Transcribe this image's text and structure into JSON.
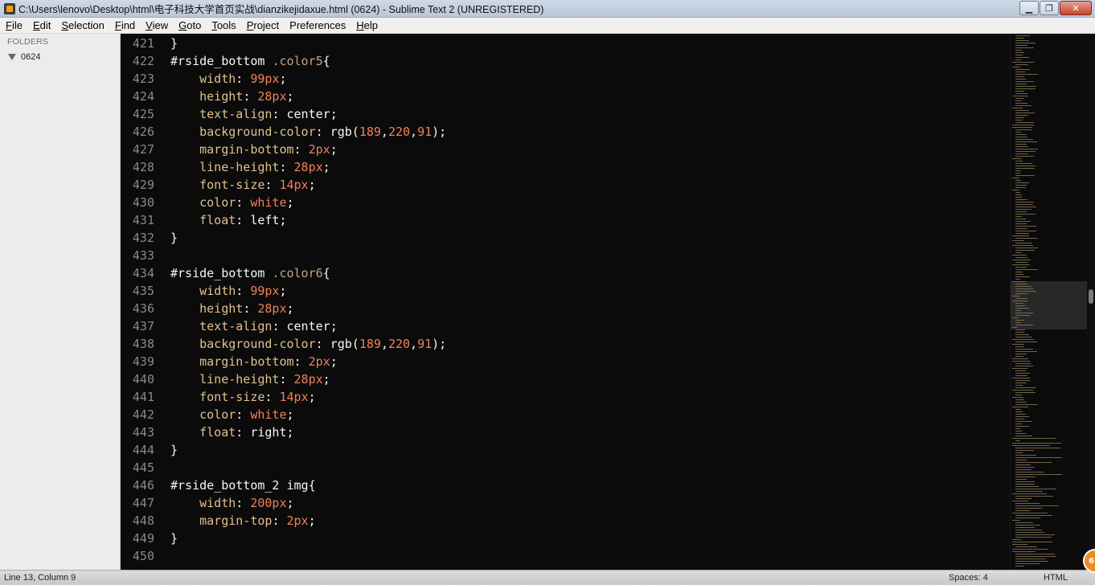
{
  "window": {
    "title": "C:\\Users\\lenovo\\Desktop\\html\\电子科技大学首页实战\\dianzikejidaxue.html (0624) - Sublime Text 2 (UNREGISTERED)",
    "minimize_glyph": "▁",
    "restore_glyph": "❐",
    "close_glyph": "✕"
  },
  "menu": [
    {
      "label": "File",
      "u": "F",
      "rest": "ile"
    },
    {
      "label": "Edit",
      "u": "E",
      "rest": "dit"
    },
    {
      "label": "Selection",
      "u": "S",
      "rest": "election"
    },
    {
      "label": "Find",
      "u": "F",
      "rest": "ind"
    },
    {
      "label": "View",
      "u": "V",
      "rest": "iew"
    },
    {
      "label": "Goto",
      "u": "G",
      "rest": "oto"
    },
    {
      "label": "Tools",
      "u": "T",
      "rest": "ools"
    },
    {
      "label": "Project",
      "u": "P",
      "rest": "roject"
    },
    {
      "label": "Preferences",
      "u": "",
      "rest": "Preferences"
    },
    {
      "label": "Help",
      "u": "H",
      "rest": "elp"
    }
  ],
  "sidebar": {
    "header": "FOLDERS",
    "folder": "0624"
  },
  "editor": {
    "lines": [
      {
        "n": "421",
        "tokens": [
          [
            "pun",
            "}"
          ]
        ]
      },
      {
        "n": "422",
        "tokens": [
          [
            "sel",
            "#rside_bottom "
          ],
          [
            "cls",
            ".color5"
          ],
          [
            "pun",
            "{"
          ]
        ]
      },
      {
        "n": "423",
        "tokens": [
          [
            "pun",
            "    "
          ],
          [
            "prop",
            "width"
          ],
          [
            "pun",
            ": "
          ],
          [
            "num",
            "99px"
          ],
          [
            "pun",
            ";"
          ]
        ]
      },
      {
        "n": "424",
        "tokens": [
          [
            "pun",
            "    "
          ],
          [
            "prop",
            "height"
          ],
          [
            "pun",
            ": "
          ],
          [
            "num",
            "28px"
          ],
          [
            "pun",
            ";"
          ]
        ]
      },
      {
        "n": "425",
        "tokens": [
          [
            "pun",
            "    "
          ],
          [
            "prop",
            "text-align"
          ],
          [
            "pun",
            ": "
          ],
          [
            "fn",
            "center"
          ],
          [
            "pun",
            ";"
          ]
        ]
      },
      {
        "n": "426",
        "tokens": [
          [
            "pun",
            "    "
          ],
          [
            "prop",
            "background-color"
          ],
          [
            "pun",
            ": "
          ],
          [
            "fn",
            "rgb("
          ],
          [
            "num",
            "189"
          ],
          [
            "pun",
            ","
          ],
          [
            "num",
            "220"
          ],
          [
            "pun",
            ","
          ],
          [
            "num",
            "91"
          ],
          [
            "pun",
            ");"
          ]
        ]
      },
      {
        "n": "427",
        "tokens": [
          [
            "pun",
            "    "
          ],
          [
            "prop",
            "margin-bottom"
          ],
          [
            "pun",
            ": "
          ],
          [
            "num",
            "2px"
          ],
          [
            "pun",
            ";"
          ]
        ]
      },
      {
        "n": "428",
        "tokens": [
          [
            "pun",
            "    "
          ],
          [
            "prop",
            "line-height"
          ],
          [
            "pun",
            ": "
          ],
          [
            "num",
            "28px"
          ],
          [
            "pun",
            ";"
          ]
        ]
      },
      {
        "n": "429",
        "tokens": [
          [
            "pun",
            "    "
          ],
          [
            "prop",
            "font-size"
          ],
          [
            "pun",
            ": "
          ],
          [
            "num",
            "14px"
          ],
          [
            "pun",
            ";"
          ]
        ]
      },
      {
        "n": "430",
        "tokens": [
          [
            "pun",
            "    "
          ],
          [
            "prop",
            "color"
          ],
          [
            "pun",
            ": "
          ],
          [
            "kw",
            "white"
          ],
          [
            "pun",
            ";"
          ]
        ]
      },
      {
        "n": "431",
        "tokens": [
          [
            "pun",
            "    "
          ],
          [
            "prop",
            "float"
          ],
          [
            "pun",
            ": "
          ],
          [
            "fn",
            "left"
          ],
          [
            "pun",
            ";"
          ]
        ]
      },
      {
        "n": "432",
        "tokens": [
          [
            "pun",
            "}"
          ]
        ]
      },
      {
        "n": "433",
        "tokens": []
      },
      {
        "n": "434",
        "tokens": [
          [
            "sel",
            "#rside_bottom "
          ],
          [
            "cls",
            ".color6"
          ],
          [
            "pun",
            "{"
          ]
        ]
      },
      {
        "n": "435",
        "tokens": [
          [
            "pun",
            "    "
          ],
          [
            "prop",
            "width"
          ],
          [
            "pun",
            ": "
          ],
          [
            "num",
            "99px"
          ],
          [
            "pun",
            ";"
          ]
        ]
      },
      {
        "n": "436",
        "tokens": [
          [
            "pun",
            "    "
          ],
          [
            "prop",
            "height"
          ],
          [
            "pun",
            ": "
          ],
          [
            "num",
            "28px"
          ],
          [
            "pun",
            ";"
          ]
        ]
      },
      {
        "n": "437",
        "tokens": [
          [
            "pun",
            "    "
          ],
          [
            "prop",
            "text-align"
          ],
          [
            "pun",
            ": "
          ],
          [
            "fn",
            "center"
          ],
          [
            "pun",
            ";"
          ]
        ]
      },
      {
        "n": "438",
        "tokens": [
          [
            "pun",
            "    "
          ],
          [
            "prop",
            "background-color"
          ],
          [
            "pun",
            ": "
          ],
          [
            "fn",
            "rgb("
          ],
          [
            "num",
            "189"
          ],
          [
            "pun",
            ","
          ],
          [
            "num",
            "220"
          ],
          [
            "pun",
            ","
          ],
          [
            "num",
            "91"
          ],
          [
            "pun",
            ");"
          ]
        ]
      },
      {
        "n": "439",
        "tokens": [
          [
            "pun",
            "    "
          ],
          [
            "prop",
            "margin-bottom"
          ],
          [
            "pun",
            ": "
          ],
          [
            "num",
            "2px"
          ],
          [
            "pun",
            ";"
          ]
        ]
      },
      {
        "n": "440",
        "tokens": [
          [
            "pun",
            "    "
          ],
          [
            "prop",
            "line-height"
          ],
          [
            "pun",
            ": "
          ],
          [
            "num",
            "28px"
          ],
          [
            "pun",
            ";"
          ]
        ]
      },
      {
        "n": "441",
        "tokens": [
          [
            "pun",
            "    "
          ],
          [
            "prop",
            "font-size"
          ],
          [
            "pun",
            ": "
          ],
          [
            "num",
            "14px"
          ],
          [
            "pun",
            ";"
          ]
        ]
      },
      {
        "n": "442",
        "tokens": [
          [
            "pun",
            "    "
          ],
          [
            "prop",
            "color"
          ],
          [
            "pun",
            ": "
          ],
          [
            "kw",
            "white"
          ],
          [
            "pun",
            ";"
          ]
        ]
      },
      {
        "n": "443",
        "tokens": [
          [
            "pun",
            "    "
          ],
          [
            "prop",
            "float"
          ],
          [
            "pun",
            ": "
          ],
          [
            "fn",
            "right"
          ],
          [
            "pun",
            ";"
          ]
        ]
      },
      {
        "n": "444",
        "tokens": [
          [
            "pun",
            "}"
          ]
        ]
      },
      {
        "n": "445",
        "tokens": []
      },
      {
        "n": "446",
        "tokens": [
          [
            "sel",
            "#rside_bottom_2 "
          ],
          [
            "fn",
            "img"
          ],
          [
            "pun",
            "{"
          ]
        ]
      },
      {
        "n": "447",
        "tokens": [
          [
            "pun",
            "    "
          ],
          [
            "prop",
            "width"
          ],
          [
            "pun",
            ": "
          ],
          [
            "num",
            "200px"
          ],
          [
            "pun",
            ";"
          ]
        ]
      },
      {
        "n": "448",
        "tokens": [
          [
            "pun",
            "    "
          ],
          [
            "prop",
            "margin-top"
          ],
          [
            "pun",
            ": "
          ],
          [
            "num",
            "2px"
          ],
          [
            "pun",
            ";"
          ]
        ]
      },
      {
        "n": "449",
        "tokens": [
          [
            "pun",
            "}"
          ]
        ]
      },
      {
        "n": "450",
        "tokens": []
      }
    ]
  },
  "status": {
    "position": "Line 13, Column 9",
    "spaces": "Spaces: 4",
    "syntax": "HTML",
    "badge": "6"
  },
  "colors": {
    "editor_bg": "#0b0b0b",
    "selector": "#f8f8f2",
    "class": "#cba37a",
    "property": "#e3c08f",
    "number": "#f0805a",
    "badge": "#f08a24"
  }
}
